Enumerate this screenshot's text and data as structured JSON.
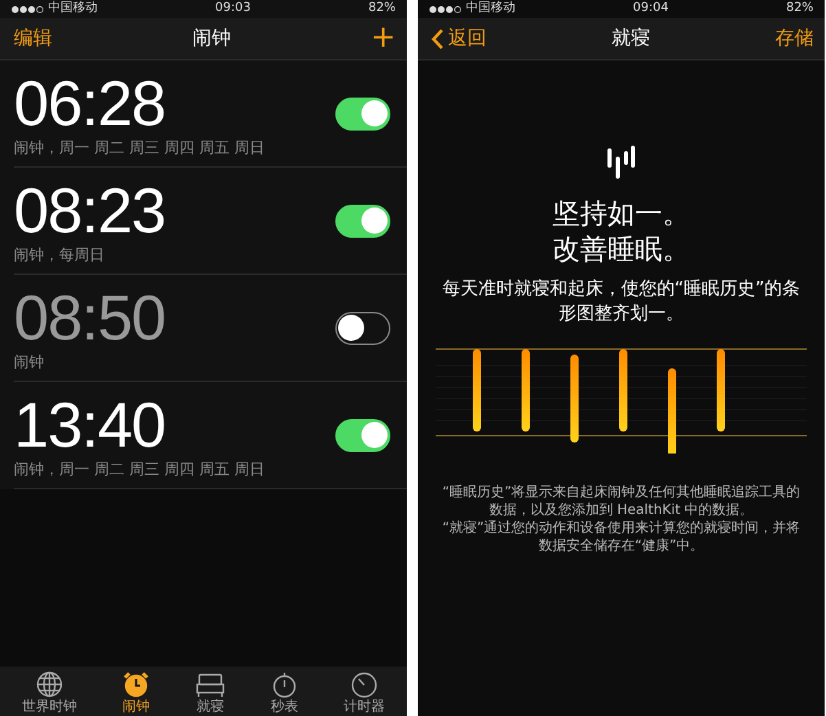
{
  "left_screen": {
    "status_bar": {
      "carrier": "中国移动",
      "time": "09:03",
      "battery": "82%"
    },
    "nav": {
      "left": "编辑",
      "title": "闹钟",
      "right": "+"
    },
    "alarms": [
      {
        "time": "06:28",
        "label": "闹钟，周一 周二 周三 周四 周五 周日",
        "on": true
      },
      {
        "time": "08:23",
        "label": "闹钟，每周日",
        "on": true
      },
      {
        "time": "08:50",
        "label": "闹钟",
        "on": false
      },
      {
        "time": "13:40",
        "label": "闹钟，周一 周二 周三 周四 周五 周日",
        "on": true
      }
    ],
    "tab_bar": [
      {
        "kind": "globe",
        "label": "世界时钟",
        "selected": false
      },
      {
        "kind": "alarm",
        "label": "闹钟",
        "selected": true
      },
      {
        "kind": "bed",
        "label": "就寝",
        "selected": false
      },
      {
        "kind": "stopwatch",
        "label": "秒表",
        "selected": false
      },
      {
        "kind": "timer",
        "label": "计时器",
        "selected": false
      }
    ]
  },
  "right_screen": {
    "status_bar": {
      "carrier": "中国移动",
      "time": "09:04",
      "battery": "82%"
    },
    "nav": {
      "back": "返回",
      "title": "就寝",
      "right": "存储"
    },
    "headline": [
      "坚持如一。",
      "改善睡眠。"
    ],
    "subtitle": "每天准时就寝和起床，使您的“睡眠历史”的条形图整齐划一。",
    "notes": [
      "“睡眠历史”将显示来自起床闹钟及任何其他睡眠追踪工具的数据，以及您添加到 HealthKit 中的数据。",
      "“就寝”通过您的动作和设备使用来计算您的就寝时间，并将数据安全储存在“健康”中。"
    ]
  }
}
